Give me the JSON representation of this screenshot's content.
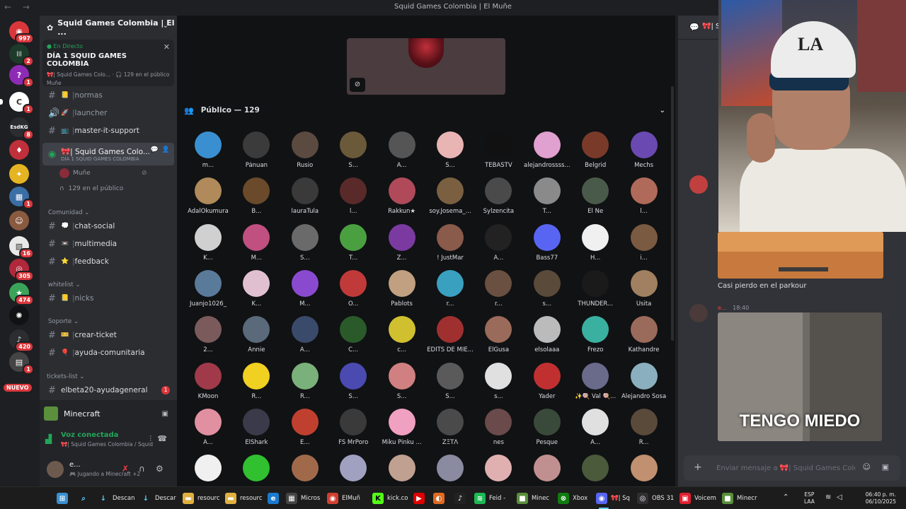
{
  "window": {
    "title": "Squid Games Colombia | El Muñe",
    "nav": "← →"
  },
  "rail": {
    "new_label": "NUEVO",
    "servers": [
      {
        "name": "discord-home",
        "glyph": "◉",
        "color": "#da373c",
        "badge": "997"
      },
      {
        "name": "green-server",
        "glyph": "|||",
        "color": "#1d3b2a",
        "badge": "2"
      },
      {
        "name": "question-server",
        "glyph": "?",
        "color": "#8e2bb5",
        "badge": "1"
      },
      {
        "name": "clan-server",
        "glyph": "C",
        "color": "#ffffff",
        "badge": "1"
      },
      {
        "name": "esdkg-server",
        "glyph": "EsdKG",
        "color": "#2b2d31",
        "badge": "8"
      },
      {
        "name": "shield-server",
        "glyph": "♦",
        "color": "#c0303a",
        "badge": ""
      },
      {
        "name": "yellow-server",
        "glyph": "✦",
        "color": "#e5b422",
        "badge": ""
      },
      {
        "name": "game-server",
        "glyph": "▦",
        "color": "#3a6ea5",
        "badge": "1"
      },
      {
        "name": "face-server",
        "glyph": "☺",
        "color": "#8a5a40",
        "badge": ""
      },
      {
        "name": "white-server",
        "glyph": "▧",
        "color": "#e8e8e8",
        "badge": "16"
      },
      {
        "name": "red-ring-server",
        "glyph": "◎",
        "color": "#b0283a",
        "badge": "305"
      },
      {
        "name": "colorful-server",
        "glyph": "★",
        "color": "#3aa55a",
        "badge": "474"
      },
      {
        "name": "spark-server",
        "glyph": "✺",
        "color": "#111214",
        "badge": ""
      },
      {
        "name": "mic-server",
        "glyph": "♪",
        "color": "#2b2d31",
        "badge": "420"
      },
      {
        "name": "dark-server",
        "glyph": "▤",
        "color": "#444",
        "badge": "1"
      }
    ]
  },
  "sidebar": {
    "guild_name": "Squid Games Colombia | El ...",
    "live": {
      "status": "En Directo",
      "event_title": "DÍA 1 SQUID GAMES COLOMBIA",
      "meta": "🎀| Squid Games Colo...  ·  🎧 129 en el público",
      "host": "Muñe"
    },
    "channels": [
      {
        "type": "text",
        "emoji": "📒",
        "label": "normas",
        "bright": false
      },
      {
        "type": "voice",
        "emoji": "🚀",
        "label": "launcher",
        "bright": false
      },
      {
        "type": "text",
        "emoji": "📺",
        "label": "master-it-support",
        "bright": true
      }
    ],
    "stage_channel": {
      "label": "🎀| Squid Games Colo...",
      "sub": "DÍA 1 SQUID GAMES COLOMBIA"
    },
    "stage_sub_host": "Muñe",
    "stage_sub_audience": "129 en el público",
    "cat_comunidad": "Comunidad",
    "comunidad": [
      {
        "emoji": "💭",
        "label": "chat-social"
      },
      {
        "emoji": "📼",
        "label": "multimedia"
      },
      {
        "emoji": "⭐",
        "label": "feedback"
      }
    ],
    "cat_whitelist": "whitelist",
    "whitelist": [
      {
        "emoji": "📒",
        "label": "nicks"
      }
    ],
    "cat_soporte": "Soporte",
    "soporte": [
      {
        "emoji": "🎫",
        "label": "crear-ticket"
      },
      {
        "emoji": "🎈",
        "label": "ayuda-comunitaria"
      }
    ],
    "cat_tickets": "tickets-list",
    "tickets": [
      {
        "label": "elbeta20-ayudageneral",
        "badge": "1"
      }
    ]
  },
  "user_panel": {
    "activity_name": "Minecraft",
    "voice_status": "Voz conectada",
    "voice_channel": "🎀| Squid Games Colombia / Squid G...",
    "username": "e...",
    "user_status": "🎮 Jugando a Minecraft +2"
  },
  "stage": {
    "audience_header": "Público — 129",
    "members": [
      {
        "name": "m...",
        "color": "#3a8fd0"
      },
      {
        "name": "Pánuan",
        "color": "#3b3b3b"
      },
      {
        "name": "Rusio",
        "color": "#5a4a40"
      },
      {
        "name": "S...",
        "color": "#6b5a3a"
      },
      {
        "name": "A...",
        "color": "#555"
      },
      {
        "name": "S...",
        "color": "#e8b4b4"
      },
      {
        "name": "TEBASTV",
        "color": "#111"
      },
      {
        "name": "alejandrossss...",
        "color": "#e0a0d0"
      },
      {
        "name": "Belgrid",
        "color": "#7a3a2a"
      },
      {
        "name": "Mechs",
        "color": "#6a4ab0"
      },
      {
        "name": "AdalOkumura",
        "color": "#b08a5a"
      },
      {
        "name": "B...",
        "color": "#6a4a2a"
      },
      {
        "name": "lauraTula",
        "color": "#3a3a3a"
      },
      {
        "name": "l...",
        "color": "#5a2a2a"
      },
      {
        "name": "Rakkun★",
        "color": "#b04a5a"
      },
      {
        "name": "soy.Josema_...",
        "color": "#7a6040"
      },
      {
        "name": "Sylzencita",
        "color": "#4a4a4a"
      },
      {
        "name": "T...",
        "color": "#8a8a8a"
      },
      {
        "name": "El Ñe",
        "color": "#4a5a4a"
      },
      {
        "name": "l...",
        "color": "#b06a5a"
      },
      {
        "name": "K...",
        "color": "#d0d0d0"
      },
      {
        "name": "M...",
        "color": "#c05080"
      },
      {
        "name": "S...",
        "color": "#6a6a6a"
      },
      {
        "name": "T...",
        "color": "#4aa040"
      },
      {
        "name": "Z...",
        "color": "#7a3aa0"
      },
      {
        "name": "! JustMar",
        "color": "#8a5a4a"
      },
      {
        "name": "A...",
        "color": "#222"
      },
      {
        "name": "Bass77",
        "color": "#5865f2"
      },
      {
        "name": "H...",
        "color": "#f0f0f0"
      },
      {
        "name": "i...",
        "color": "#7a5a40"
      },
      {
        "name": "Juanjo1026_",
        "color": "#5a7a9a"
      },
      {
        "name": "K...",
        "color": "#e0c0d0"
      },
      {
        "name": "M...",
        "color": "#8a4ad0"
      },
      {
        "name": "O...",
        "color": "#c03a3a"
      },
      {
        "name": "Pablots",
        "color": "#c0a080"
      },
      {
        "name": "r...",
        "color": "#3aa0c0"
      },
      {
        "name": "r...",
        "color": "#6a5040"
      },
      {
        "name": "s...",
        "color": "#5a4a3a"
      },
      {
        "name": "THUNDER...",
        "color": "#1a1a1a"
      },
      {
        "name": "Usita",
        "color": "#a08060"
      },
      {
        "name": "2...",
        "color": "#7a5a5a"
      },
      {
        "name": "Annie",
        "color": "#5a6a7a"
      },
      {
        "name": "A...",
        "color": "#3a4a6a"
      },
      {
        "name": "C...",
        "color": "#2a5a2a"
      },
      {
        "name": "c...",
        "color": "#d0c030"
      },
      {
        "name": "EDITS DE MIE...",
        "color": "#a03030"
      },
      {
        "name": "ElGusa",
        "color": "#9a6a5a"
      },
      {
        "name": "elsolaaa",
        "color": "#bbb"
      },
      {
        "name": "Frezo",
        "color": "#3ab0a0"
      },
      {
        "name": "Kathandre",
        "color": "#9a6a5a"
      },
      {
        "name": "KMoon",
        "color": "#a03a4a"
      },
      {
        "name": "R...",
        "color": "#f0d020"
      },
      {
        "name": "R...",
        "color": "#7ab07a"
      },
      {
        "name": "S...",
        "color": "#4a4ab0"
      },
      {
        "name": "S...",
        "color": "#d08080"
      },
      {
        "name": "S...",
        "color": "#5a5a5a"
      },
      {
        "name": "s...",
        "color": "#e0e0e0"
      },
      {
        "name": "Yader",
        "color": "#c03030"
      },
      {
        "name": "✨🍭 Val 🍭...",
        "color": "#6a6a8a"
      },
      {
        "name": "Alejandro Sosa",
        "color": "#8ab0c0"
      },
      {
        "name": "A...",
        "color": "#e090a0"
      },
      {
        "name": "ElShark",
        "color": "#3a3a4a"
      },
      {
        "name": "E...",
        "color": "#c04030"
      },
      {
        "name": "FS MrPoro",
        "color": "#3a3a3a"
      },
      {
        "name": "Miku Pinku ...",
        "color": "#f0a0c0"
      },
      {
        "name": "ZΞTΛ",
        "color": "#4a4a4a"
      },
      {
        "name": "nes",
        "color": "#6a4a4a"
      },
      {
        "name": "Pesque",
        "color": "#3a4a3a"
      },
      {
        "name": "A...",
        "color": "#e0e0e0"
      },
      {
        "name": "R...",
        "color": "#5a4a3a"
      },
      {
        "name": "",
        "color": "#f0f0f0"
      },
      {
        "name": "",
        "color": "#30c030"
      },
      {
        "name": "",
        "color": "#a06a4a"
      },
      {
        "name": "",
        "color": "#a0a0c0"
      },
      {
        "name": "",
        "color": "#c0a090"
      },
      {
        "name": "",
        "color": "#8a8aa0"
      },
      {
        "name": "",
        "color": "#e0b0b0"
      },
      {
        "name": "",
        "color": "#c09090"
      },
      {
        "name": "",
        "color": "#4a5a3a"
      },
      {
        "name": "",
        "color": "#c09070"
      }
    ]
  },
  "chat": {
    "header": "🎀| S",
    "msg1": "Casi pierdo en el parkour",
    "msg2_user": "e...",
    "msg2_time": "18:40",
    "gif_caption": "TENGO MIEDO",
    "input_placeholder": "Enviar mensaje a 🎀| Squid Games Colo..."
  },
  "taskbar": {
    "items": [
      {
        "name": "start",
        "label": "",
        "icon": "⊞",
        "color": "#3a8fd0"
      },
      {
        "name": "search",
        "label": "",
        "icon": "⌕",
        "color": "transparent"
      },
      {
        "name": "download-1",
        "label": "Descan",
        "icon": "↓",
        "color": "transparent"
      },
      {
        "name": "download-2",
        "label": "Descar",
        "icon": "↓",
        "color": "transparent"
      },
      {
        "name": "folder-1",
        "label": "resourc",
        "icon": "▬",
        "color": "#e0b040"
      },
      {
        "name": "folder-2",
        "label": "resourc",
        "icon": "▬",
        "color": "#e0b040"
      },
      {
        "name": "edge",
        "label": "",
        "icon": "e",
        "color": "#1a7ad0"
      },
      {
        "name": "microsoft",
        "label": "Micros",
        "icon": "▦",
        "color": "#444"
      },
      {
        "name": "chrome",
        "label": "ElMuñ",
        "icon": "◉",
        "color": "#d04030"
      },
      {
        "name": "kick",
        "label": "kick.co",
        "icon": "K",
        "color": "#53fc18"
      },
      {
        "name": "youtube",
        "label": "",
        "icon": "▶",
        "color": "#e00000"
      },
      {
        "name": "firefox",
        "label": "",
        "icon": "◐",
        "color": "#e06a20"
      },
      {
        "name": "tiktok",
        "label": "",
        "icon": "♪",
        "color": "#222"
      },
      {
        "name": "spotify",
        "label": "Feid -",
        "icon": "≋",
        "color": "#1db954"
      },
      {
        "name": "minecraft-1",
        "label": "Minec",
        "icon": "■",
        "color": "#5a8f3c"
      },
      {
        "name": "xbox",
        "label": "Xbox",
        "icon": "⊗",
        "color": "#107c10"
      },
      {
        "name": "discord",
        "label": "🎀| Sq",
        "icon": "◉",
        "color": "#5865f2"
      },
      {
        "name": "obs",
        "label": "OBS 31",
        "icon": "◎",
        "color": "#302e31"
      },
      {
        "name": "voicemod",
        "label": "Voicem",
        "icon": "▣",
        "color": "#e02030"
      },
      {
        "name": "minecraft-2",
        "label": "Minecr",
        "icon": "■",
        "color": "#5a8f3c"
      }
    ],
    "lang_top": "ESP",
    "lang_bottom": "LAA",
    "time": "06:40 p. m.",
    "date": "06/10/2025"
  }
}
